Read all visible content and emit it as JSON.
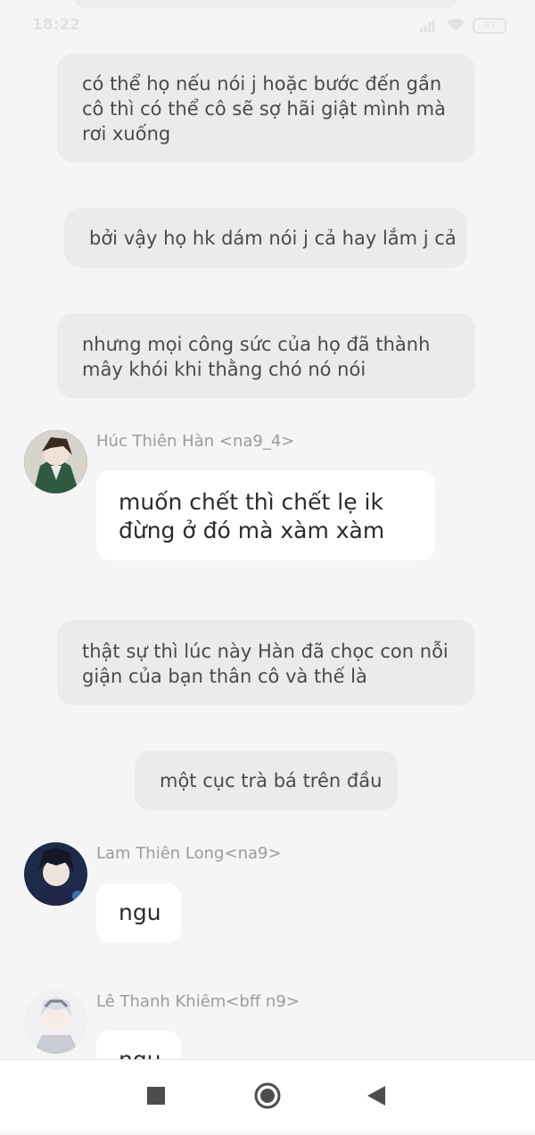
{
  "status_bar": {
    "time": "18:22",
    "battery": "83"
  },
  "narration": [
    {
      "text": "có thể họ nếu nói j hoặc bước đến gần cô thì có thể cô sẽ sợ hãi giật mình mà rơi xuống"
    },
    {
      "text": "bởi vậy họ hk dám nói j cả hay lắm j cả"
    },
    {
      "text": "nhưng mọi công sức của họ đã thành mây khói khi thằng chó nó nói"
    },
    {
      "text": "thật sự thì lúc này Hàn đã chọc con nỗi giận của  bạn thân cô và thế là"
    },
    {
      "text": "một cục trà bá trên đầu"
    }
  ],
  "messages": [
    {
      "sender": "Húc Thiên Hàn <na9_4>",
      "text": "muốn chết thì chết lẹ ik đừng ở đó mà xàm xàm"
    },
    {
      "sender": "Lam Thiên Long<na9>",
      "text": "ngu"
    },
    {
      "sender": "Lê Thanh Khiêm<bff n9>",
      "text": "ngu"
    }
  ],
  "colors": {
    "background": "#f5f5f5",
    "narration_bubble": "#ebebeb",
    "message_bubble": "#ffffff",
    "sender_name": "#9b9b9b"
  },
  "nav": {
    "icons": [
      "recent-apps-icon",
      "home-icon",
      "back-icon"
    ]
  }
}
